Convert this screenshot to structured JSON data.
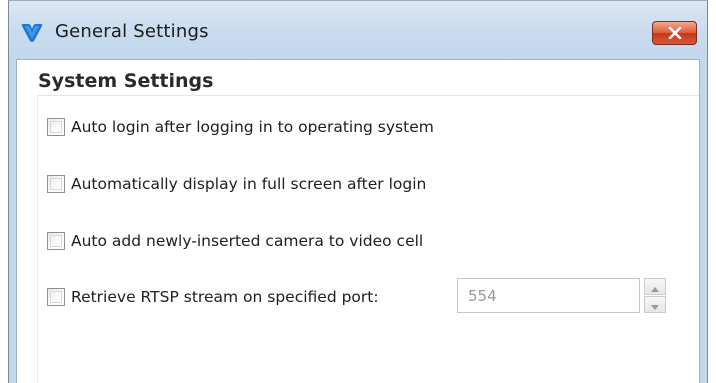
{
  "window": {
    "title": "General Settings",
    "icon": "app-logo-icon",
    "close_icon": "close-icon"
  },
  "section": {
    "title": "System Settings"
  },
  "options": [
    {
      "label": "Auto login after logging in to operating system",
      "checked": false
    },
    {
      "label": "Automatically display in full screen after login",
      "checked": false
    },
    {
      "label": "Auto add newly-inserted camera to video cell",
      "checked": false
    },
    {
      "label": "Retrieve RTSP stream on specified port:",
      "checked": false
    }
  ],
  "port": {
    "value": "554",
    "up_icon": "spin-up-icon",
    "down_icon": "spin-down-icon"
  },
  "colors": {
    "titlebar": "#c9dcef",
    "close_button": "#d5573a",
    "logo": "#1e78d2"
  }
}
